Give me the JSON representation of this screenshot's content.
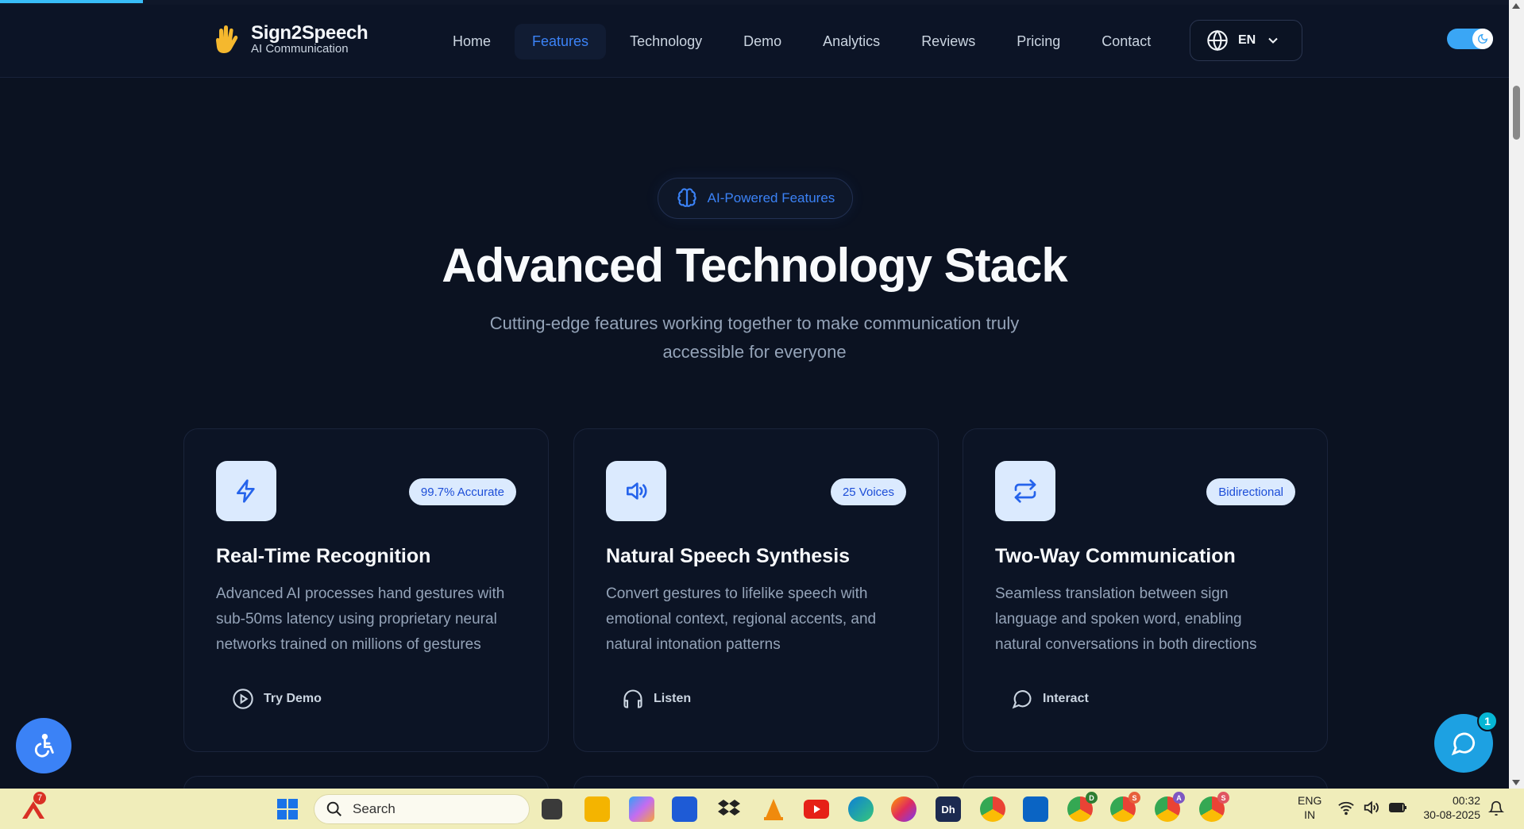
{
  "header": {
    "brand_title": "Sign2Speech",
    "brand_subtitle": "AI Communication",
    "nav": [
      {
        "label": "Home"
      },
      {
        "label": "Features"
      },
      {
        "label": "Technology"
      },
      {
        "label": "Demo"
      },
      {
        "label": "Analytics"
      },
      {
        "label": "Reviews"
      },
      {
        "label": "Pricing"
      },
      {
        "label": "Contact"
      }
    ],
    "active_nav": "Features",
    "language": "EN",
    "theme": "dark"
  },
  "hero": {
    "pill_label": "AI-Powered Features",
    "title": "Advanced Technology Stack",
    "subtitle_line1": "Cutting-edge features working together to make communication truly",
    "subtitle_line2": "accessible for everyone"
  },
  "cards": [
    {
      "icon": "zap-icon",
      "badge": "99.7% Accurate",
      "title": "Real-Time Recognition",
      "desc_lines": [
        "Advanced AI processes hand gestures with",
        "sub-50ms latency using proprietary neural",
        "networks trained on millions of gestures"
      ],
      "action_icon": "play-circle-icon",
      "action_label": "Try Demo"
    },
    {
      "icon": "volume-icon",
      "badge": "25 Voices",
      "title": "Natural Speech Synthesis",
      "desc_lines": [
        "Convert gestures to lifelike speech with",
        "emotional context, regional accents, and",
        "natural intonation patterns"
      ],
      "action_icon": "headphones-icon",
      "action_label": "Listen"
    },
    {
      "icon": "repeat-icon",
      "badge": "Bidirectional",
      "title": "Two-Way Communication",
      "desc_lines": [
        "Seamless translation between sign",
        "language and spoken word, enabling",
        "natural conversations in both directions"
      ],
      "action_icon": "message-circle-icon",
      "action_label": "Interact"
    }
  ],
  "floating": {
    "chat_badge": "1"
  },
  "taskbar": {
    "weather_badge": "7",
    "search_placeholder": "Search",
    "apps": [
      {
        "name": "task-view-icon"
      },
      {
        "name": "file-explorer-icon"
      },
      {
        "name": "copilot-icon"
      },
      {
        "name": "microsoft-store-icon"
      },
      {
        "name": "dropbox-icon"
      },
      {
        "name": "vlc-icon"
      },
      {
        "name": "youtube-icon"
      },
      {
        "name": "edge-icon"
      },
      {
        "name": "firefox-icon"
      },
      {
        "name": "dh-app-icon",
        "label": "Dh"
      },
      {
        "name": "chrome-icon"
      },
      {
        "name": "outlook-icon"
      },
      {
        "name": "chrome-profile-d-icon",
        "badge": "D"
      },
      {
        "name": "chrome-profile-s-icon",
        "badge": "S"
      },
      {
        "name": "chrome-profile-a-icon",
        "badge": "A"
      },
      {
        "name": "chrome-profile-s2-icon",
        "badge": "S"
      }
    ],
    "lang_line1": "ENG",
    "lang_line2": "IN",
    "time": "00:32",
    "date": "30-08-2025"
  },
  "colors": {
    "background": "#0b1221",
    "accent": "#3b82f6",
    "badge_bg": "#dbeafe",
    "toggle": "#3aa6f5",
    "chat_button": "#1da1e2",
    "taskbar": "#f0edba"
  }
}
